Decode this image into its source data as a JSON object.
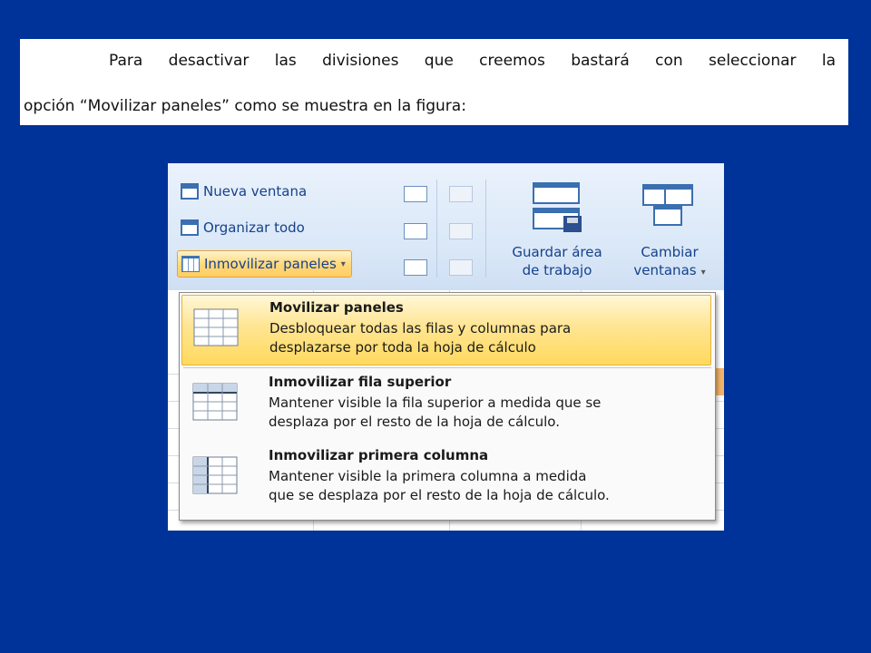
{
  "instruction": {
    "line1": "Para desactivar las divisiones que creemos bastará con seleccionar la",
    "line2": "opción “Movilizar paneles” como se muestra en la figura:"
  },
  "ribbon": {
    "nueva_ventana": "Nueva ventana",
    "organizar_todo": "Organizar todo",
    "inmovilizar_paneles": "Inmovilizar paneles",
    "guardar_area": "Guardar área",
    "de_trabajo": "de trabajo",
    "cambiar": "Cambiar",
    "ventanas": "ventanas",
    "dropdown_arrow": "▾"
  },
  "menu": {
    "items": [
      {
        "title": "Movilizar paneles",
        "desc1": "Desbloquear todas las filas y columnas para",
        "desc2": "desplazarse por toda la hoja de cálculo",
        "highlighted": true
      },
      {
        "title": "Inmovilizar fila superior",
        "desc1": "Mantener visible la fila superior a medida que se",
        "desc2": "desplaza por el resto de la hoja de cálculo.",
        "highlighted": false
      },
      {
        "title": "Inmovilizar primera columna",
        "desc1": "Mantener visible la primera columna a medida",
        "desc2": "que se desplaza por el resto de la hoja de cálculo.",
        "highlighted": false
      }
    ]
  },
  "colors": {
    "background": "#003399",
    "ribbon_text": "#15428b",
    "highlight": "#ffd95e"
  }
}
